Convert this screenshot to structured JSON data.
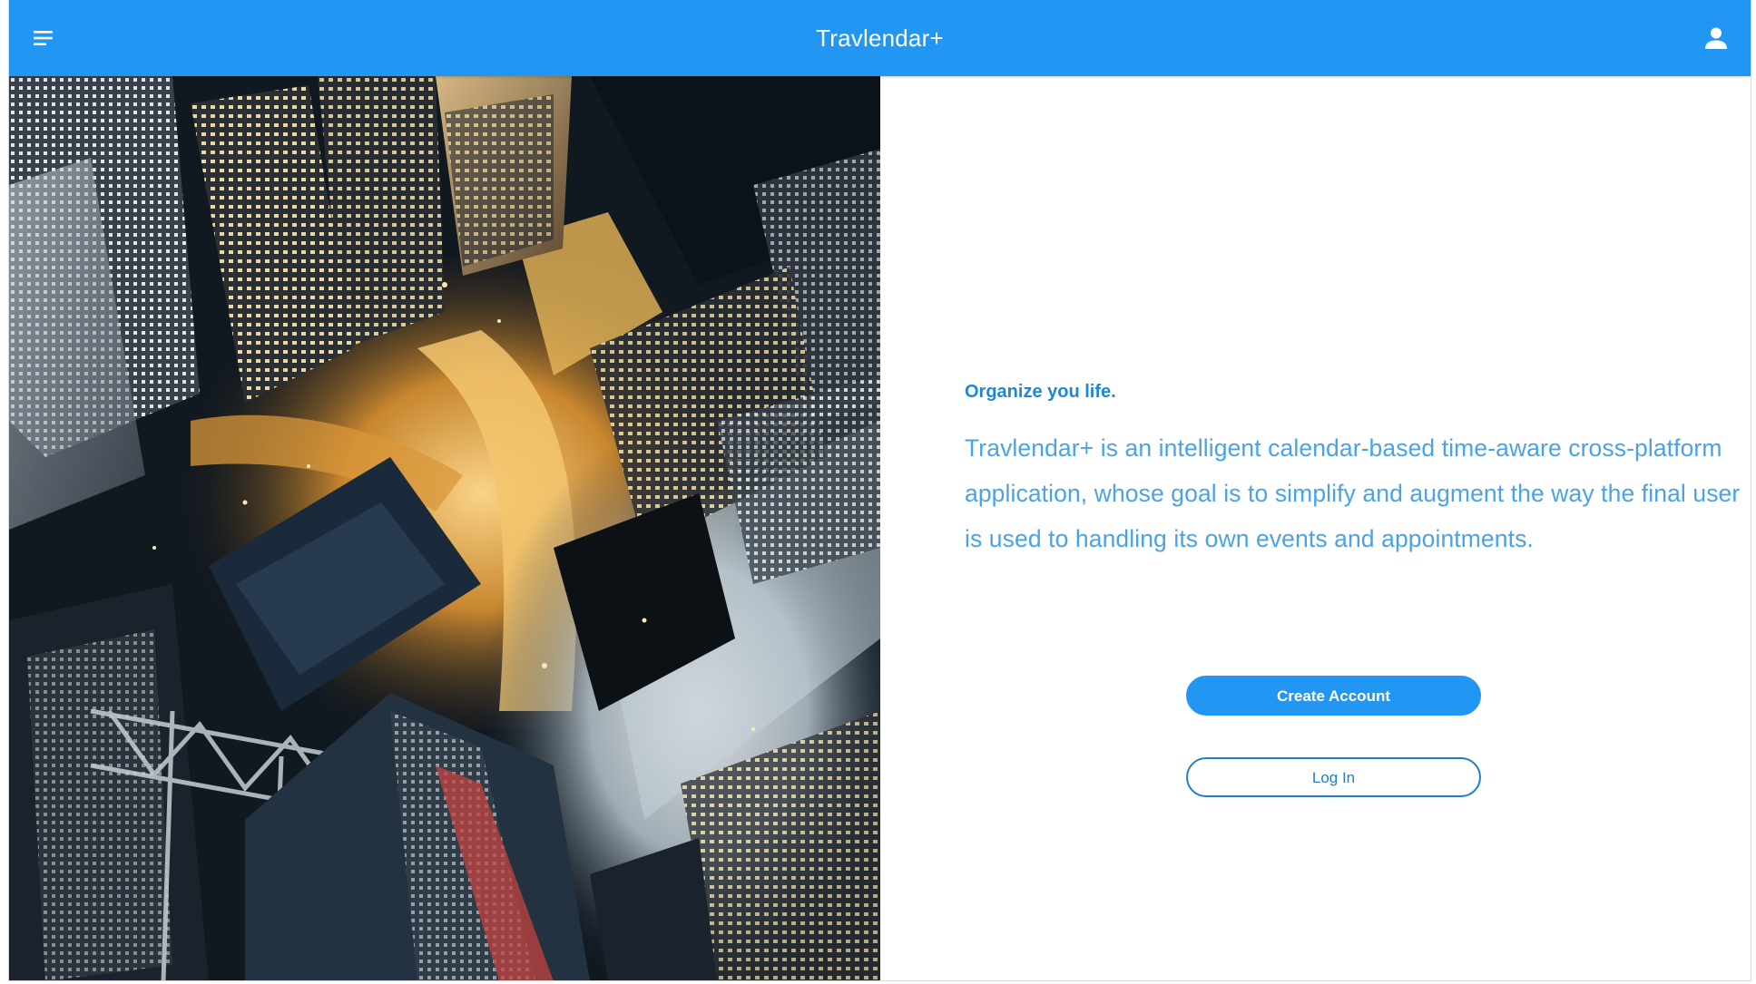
{
  "app_bar": {
    "title": "Travlendar+",
    "color": "#2196f3",
    "menu_icon": "menu-icon",
    "account_icon": "account-icon"
  },
  "hero": {
    "image": "aerial-night-city-photo"
  },
  "main": {
    "tagline": "Organize you life.",
    "description": "Travlendar+ is an intelligent calendar-based time-aware cross-platform application, whose goal is to simplify and augment the way the final user is used to handling its own events and appointments.",
    "create_account_label": "Create Account",
    "login_label": "Log In"
  }
}
